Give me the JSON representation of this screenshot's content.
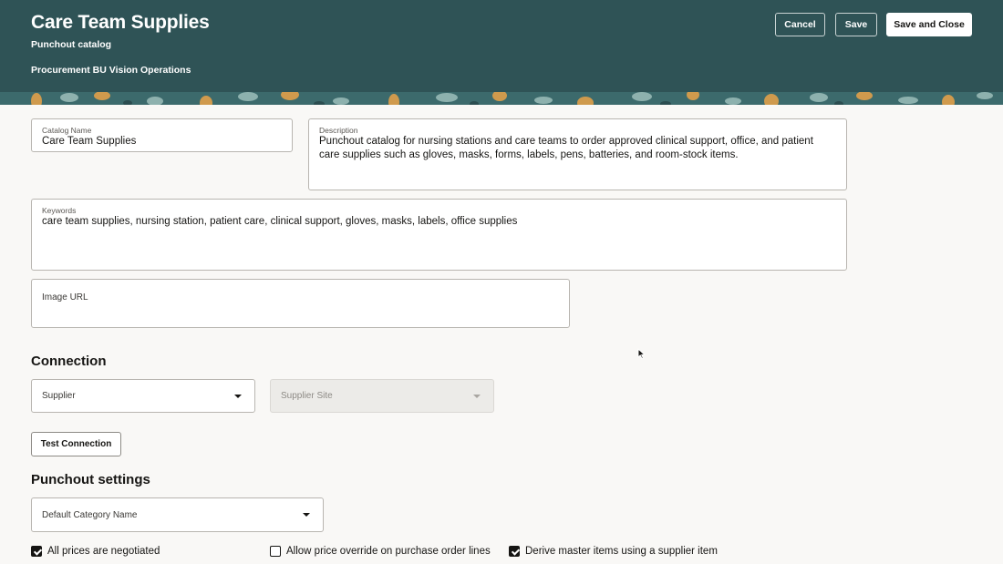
{
  "header": {
    "title": "Care Team Supplies",
    "subtitle": "Punchout catalog",
    "business_unit": "Procurement BU Vision Operations",
    "cancel_label": "Cancel",
    "save_label": "Save",
    "save_close_label": "Save and Close",
    "colors": {
      "background": "#2f5356",
      "pattern_accent": "#e0a04a"
    }
  },
  "form": {
    "catalog_name": {
      "label": "Catalog Name",
      "value": "Care Team Supplies"
    },
    "description": {
      "label": "Description",
      "value": "Punchout catalog for nursing stations and care teams to order approved clinical support, office, and patient care supplies such as gloves, masks, forms, labels, pens, batteries, and room-stock items."
    },
    "keywords": {
      "label": "Keywords",
      "value": "care team supplies, nursing station, patient care, clinical support, gloves, masks, labels, office supplies"
    },
    "image_url": {
      "label": "Image URL",
      "value": ""
    }
  },
  "connection": {
    "title": "Connection",
    "supplier": {
      "label": "Supplier",
      "value": ""
    },
    "supplier_site": {
      "label": "Supplier Site",
      "value": "",
      "disabled": true
    },
    "test_button_label": "Test Connection"
  },
  "punchout": {
    "title": "Punchout settings",
    "default_category": {
      "label": "Default Category Name",
      "value": ""
    },
    "checkboxes": [
      {
        "label": "All prices are negotiated",
        "checked": true
      },
      {
        "label": "Allow price override on purchase order lines",
        "checked": false
      },
      {
        "label": "Derive master items using a supplier item",
        "checked": true
      }
    ]
  }
}
